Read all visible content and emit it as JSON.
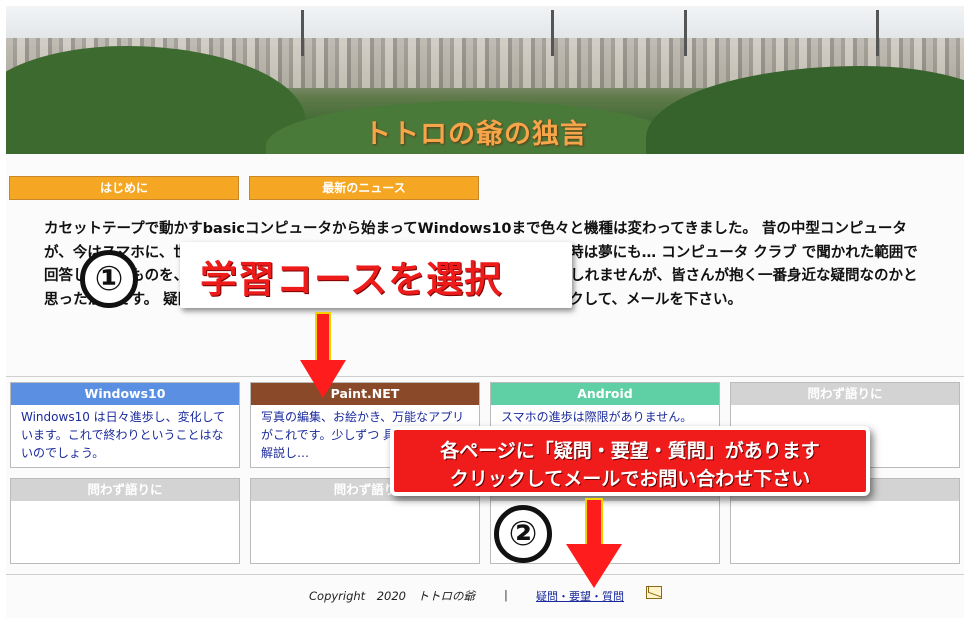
{
  "banner": {
    "title": "トトロの爺の独言"
  },
  "menu": {
    "buttons": [
      {
        "label": "はじめに"
      },
      {
        "label": "最新のニュース"
      }
    ]
  },
  "intro": {
    "paragraph": "カセットテープで動かすbasicコンピュータから始まってWindows10まで色々と機種は変わってきました。 昔の中型コンピュータが、今はスマホに、世の中の情報を指一本で 手に入れられる時代が来るなど、当時は夢にも… コンピュータ クラブ で聞かれた範囲で回答してきたものを、ここに残 すことにしたのは、…あまり役には立たないかもしれませんが、皆さんが抱く一番身近な疑問なのかと思ったからです。 疑問・質問・要望、何でも最下段の「お問い合わせ」をクリックして、メールを下さい。"
  },
  "cards": [
    {
      "title": "Windows10",
      "color": "#5b8fe2",
      "body": "Windows10 は日々進歩し、変化しています。これで終わりということはないのでしょう。"
    },
    {
      "title": "Paint.NET",
      "color": "#8a4a2a",
      "body": "写真の編集、お絵かき、万能なアプリがこれです。少しずつ 具体的な事例で解説し…"
    },
    {
      "title": "Android",
      "color": "#5fcfa6",
      "body": "スマホの進歩は際限がありません。"
    },
    {
      "title": "問わず語りに",
      "color": "#d3d3d3",
      "body": ""
    },
    {
      "title": "問わず語りに",
      "color": "#d3d3d3",
      "body": ""
    },
    {
      "title": "問わず語り",
      "color": "#d3d3d3",
      "body": ""
    },
    {
      "title": "",
      "color": "#d3d3d3",
      "body": ""
    },
    {
      "title": "",
      "color": "#d3d3d3",
      "body": ""
    }
  ],
  "footer": {
    "copyright": "Copyright　2020　トトロの爺",
    "separator": "|",
    "link": "疑問・要望・質問"
  },
  "annotations": {
    "step1_number": "①",
    "step1_text": "学習コースを選択",
    "step2_number": "②",
    "step2_line1": "各ページに「疑問・要望・質問」があります",
    "step2_line2": "クリックしてメールでお問い合わせ下さい"
  },
  "colors": {
    "menu_orange": "#f5a623",
    "annotation_red": "#ee1b1b",
    "arrow_yellow": "#f5d300",
    "link_blue": "#1a2a9c"
  }
}
